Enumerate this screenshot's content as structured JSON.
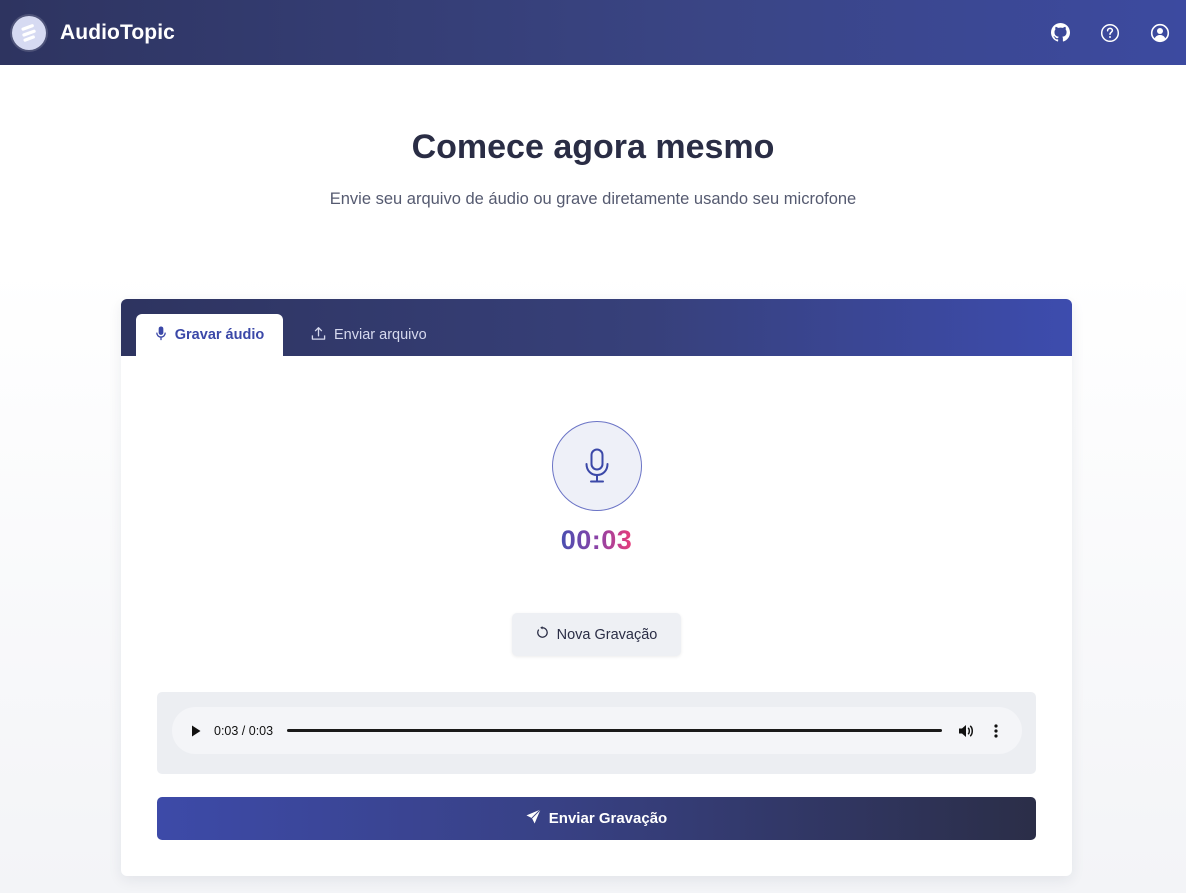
{
  "header": {
    "brand": "AudioTopic",
    "icons": [
      "github-icon",
      "help-icon",
      "account-icon"
    ]
  },
  "hero": {
    "title": "Comece agora mesmo",
    "subtitle": "Envie seu arquivo de áudio ou grave diretamente usando seu microfone"
  },
  "tabs": [
    {
      "label": "Gravar áudio",
      "icon": "microphone-icon",
      "active": true
    },
    {
      "label": "Enviar arquivo",
      "icon": "upload-icon",
      "active": false
    }
  ],
  "recorder": {
    "timer": "00:03",
    "new_recording_label": "Nova Gravação"
  },
  "player": {
    "time": "0:03 / 0:03"
  },
  "send": {
    "label": "Enviar Gravação"
  },
  "colors": {
    "header_start": "#2e3460",
    "header_end": "#3c4aa0",
    "accent": "#3b48a8",
    "timer_start": "#4a4fb0",
    "timer_end": "#e83c7a"
  }
}
